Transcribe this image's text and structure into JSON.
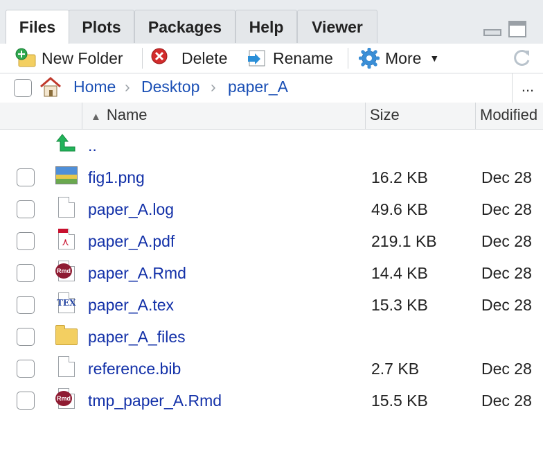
{
  "tabs": [
    {
      "label": "Files",
      "active": true
    },
    {
      "label": "Plots",
      "active": false
    },
    {
      "label": "Packages",
      "active": false
    },
    {
      "label": "Help",
      "active": false
    },
    {
      "label": "Viewer",
      "active": false
    }
  ],
  "toolbar": {
    "new_folder": "New Folder",
    "delete": "Delete",
    "rename": "Rename",
    "more": "More"
  },
  "breadcrumb": [
    "Home",
    "Desktop",
    "paper_A"
  ],
  "breadcrumb_more": "...",
  "columns": {
    "name": "Name",
    "size": "Size",
    "modified": "Modified"
  },
  "parent_dir": "..",
  "files": [
    {
      "name": "fig1.png",
      "size": "16.2 KB",
      "modified": "Dec 28",
      "icon": "image-icon"
    },
    {
      "name": "paper_A.log",
      "size": "49.6 KB",
      "modified": "Dec 28",
      "icon": "text-file-icon"
    },
    {
      "name": "paper_A.pdf",
      "size": "219.1 KB",
      "modified": "Dec 28",
      "icon": "pdf-icon"
    },
    {
      "name": "paper_A.Rmd",
      "size": "14.4 KB",
      "modified": "Dec 28",
      "icon": "rmd-icon"
    },
    {
      "name": "paper_A.tex",
      "size": "15.3 KB",
      "modified": "Dec 28",
      "icon": "tex-icon"
    },
    {
      "name": "paper_A_files",
      "size": "",
      "modified": "",
      "icon": "folder-icon"
    },
    {
      "name": "reference.bib",
      "size": "2.7 KB",
      "modified": "Dec 28",
      "icon": "text-file-icon"
    },
    {
      "name": "tmp_paper_A.Rmd",
      "size": "15.5 KB",
      "modified": "Dec 28",
      "icon": "rmd-icon"
    }
  ],
  "colors": {
    "link": "#1a4fb5",
    "filename": "#1230a8",
    "tabbar_bg": "#e9ecef"
  }
}
